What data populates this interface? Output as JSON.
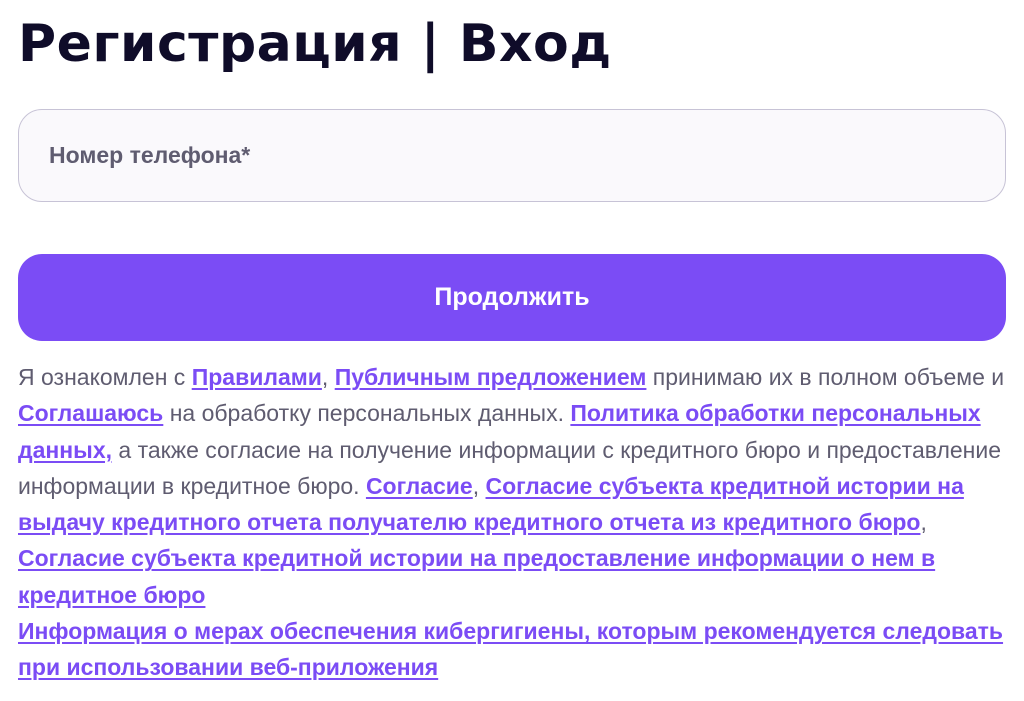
{
  "header": {
    "title": "Регистрация | Вход"
  },
  "form": {
    "phone_placeholder": "Номер телефона*",
    "phone_value": "",
    "continue_label": "Продолжить"
  },
  "consent": {
    "t1": "Я ознакомлен с ",
    "link_rules": "Правилами",
    "t2": ", ",
    "link_public_offer": "Публичным предложением",
    "t3": " принимаю их в полном объеме и ",
    "link_agree": "Соглашаюсь",
    "t4": " на обработку персональных данных. ",
    "link_privacy_policy": "Политика обработки персональных данных,",
    "t5": " а также согласие на получение информации с кредитного бюро и предоставление информации в кредитное бюро. ",
    "link_consent": "Согласие",
    "t6": ", ",
    "link_consent_report": "Согласие субъекта кредитной истории на выдачу кредитного отчета получателю кредитного отчета из кредитного бюро",
    "t7": ", ",
    "link_consent_provide": "Согласие субъекта кредитной истории на предоставление информации о нем в кредитное бюро",
    "link_cyber_hygiene": "Информация о мерах обеспечения кибергигиены, которым рекомендуется следовать при использовании веб-приложения"
  },
  "colors": {
    "accent": "#7b4cf5",
    "title": "#0f0c29",
    "body_text": "#5f5c70",
    "field_border": "#c7c3d6",
    "field_background": "#faf9fc"
  }
}
